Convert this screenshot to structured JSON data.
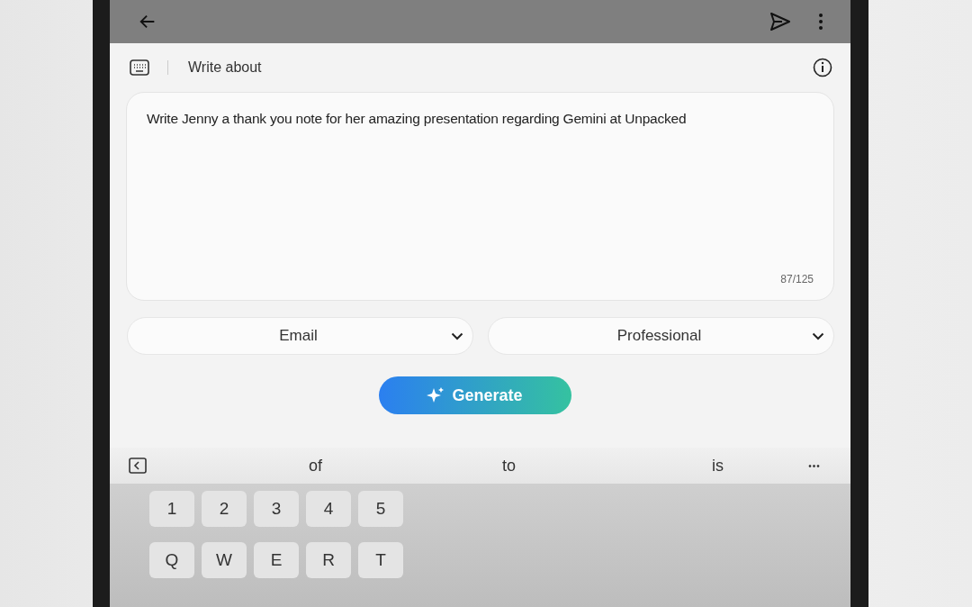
{
  "header": {
    "title": "Write about"
  },
  "prompt": {
    "value": "Write Jenny a thank you note for her amazing presentation regarding Gemini at Unpacked",
    "counter": "87/125"
  },
  "dropdowns": [
    {
      "value": "Email"
    },
    {
      "value": "Professional"
    }
  ],
  "generate_button": {
    "label": "Generate"
  },
  "suggestions": [
    "of",
    "to",
    "is"
  ],
  "more_suggestions": "•••",
  "keyboard": {
    "rows": [
      [
        "1",
        "2",
        "3",
        "4",
        "5"
      ],
      [
        "Q",
        "W",
        "E",
        "R",
        "T"
      ]
    ]
  }
}
